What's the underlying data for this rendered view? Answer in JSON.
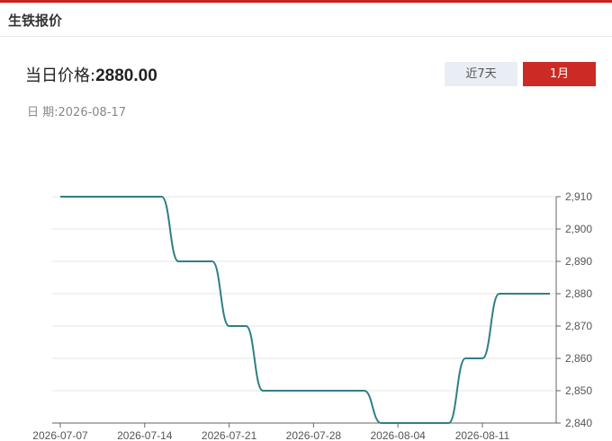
{
  "header": {
    "title": "生铁报价"
  },
  "price": {
    "label": "当日价格:",
    "value": "2880.00"
  },
  "date": {
    "label": "日 期:",
    "value": "2026-08-17"
  },
  "tabs": [
    {
      "label": "近7天",
      "active": false
    },
    {
      "label": "1月",
      "active": true
    }
  ],
  "colors": {
    "accent": "#c8231d",
    "line": "#2f7f85",
    "tab_inactive": "#e9eef5"
  },
  "chart_data": {
    "type": "line",
    "x": [
      "2026-07-07",
      "2026-07-08",
      "2026-07-09",
      "2026-07-10",
      "2026-07-13",
      "2026-07-14",
      "2026-07-15",
      "2026-07-16",
      "2026-07-17",
      "2026-07-20",
      "2026-07-21",
      "2026-07-22",
      "2026-07-23",
      "2026-07-24",
      "2026-07-27",
      "2026-07-28",
      "2026-07-29",
      "2026-07-30",
      "2026-07-31",
      "2026-08-03",
      "2026-08-04",
      "2026-08-05",
      "2026-08-06",
      "2026-08-07",
      "2026-08-10",
      "2026-08-11",
      "2026-08-12",
      "2026-08-13",
      "2026-08-14",
      "2026-08-17"
    ],
    "series": [
      {
        "values": [
          2910,
          2910,
          2910,
          2910,
          2910,
          2910,
          2910,
          2890,
          2890,
          2890,
          2870,
          2870,
          2850,
          2850,
          2850,
          2850,
          2850,
          2850,
          2850,
          2840,
          2840,
          2840,
          2840,
          2840,
          2860,
          2860,
          2880,
          2880,
          2880,
          2880
        ]
      }
    ],
    "xticks": [
      "2026-07-07",
      "2026-07-14",
      "2026-07-21",
      "2026-07-28",
      "2026-08-04",
      "2026-08-11"
    ],
    "yticks": [
      "2,840",
      "2,850",
      "2,860",
      "2,870",
      "2,880",
      "2,890",
      "2,900",
      "2,910"
    ],
    "ylim": [
      2840,
      2910
    ],
    "grid": true,
    "title": "",
    "xlabel": "",
    "ylabel": ""
  }
}
